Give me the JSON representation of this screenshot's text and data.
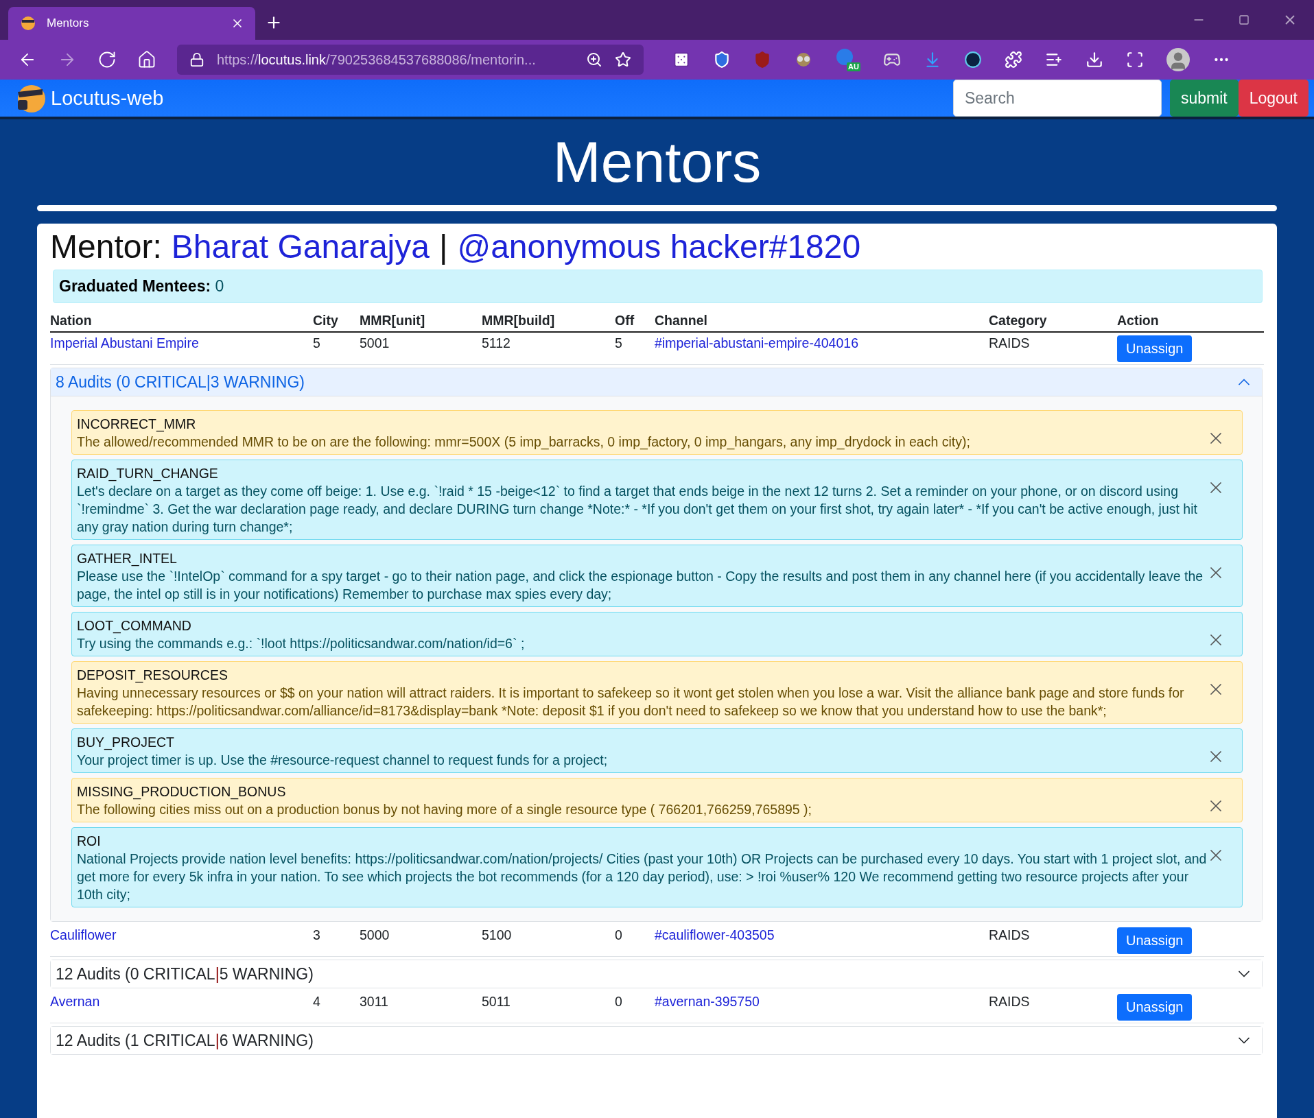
{
  "browser": {
    "tab_title": "Mentors",
    "url_scheme": "https://",
    "url_host": "locutus.link",
    "url_path": "/790253684537688086/mentorin...",
    "extension_badge": "AU"
  },
  "navbar": {
    "brand": "Locutus-web",
    "search": {
      "placeholder": "Search"
    },
    "buttons": [
      {
        "label": "submit",
        "kind": "submit"
      },
      {
        "label": "Logout",
        "kind": "logout"
      }
    ]
  },
  "page_title": "Mentors",
  "mentor": {
    "label": "Mentor:",
    "name": "Bharat Ganarajya",
    "separator": "|",
    "handle": "@anonymous hacker#1820"
  },
  "graduated": {
    "label": "Graduated Mentees:",
    "value": "0"
  },
  "table": {
    "columns": [
      "Nation",
      "City",
      "MMR[unit]",
      "MMR[build]",
      "Off",
      "Channel",
      "Category",
      "Action"
    ],
    "rows": [
      {
        "nation": "Imperial Abustani Empire",
        "city": "5",
        "mmr_unit": "5001",
        "mmr_build": "5112",
        "off": "5",
        "channel": "#imperial-abustani-empire-404016",
        "category": "RAIDS",
        "action": "Unassign",
        "audits": {
          "count": "8 Audits (0 CRITICAL",
          "separator": "|",
          "warnings": "3 WARNING)",
          "expanded": true,
          "items": [
            {
              "kind": "warning",
              "code": "INCORRECT_MMR",
              "message": "The allowed/recommended MMR to be on are the following: mmr=500X (5 imp_barracks, 0 imp_factory, 0 imp_hangars, any imp_drydock in each city);"
            },
            {
              "kind": "info",
              "code": "RAID_TURN_CHANGE",
              "message": "Let's declare on a target as they come off beige: 1. Use e.g. `!raid * 15 -beige<12` to find a target that ends beige in the next 12 turns 2. Set a reminder on your phone, or on discord using `!remindme` 3. Get the war declaration page ready, and declare DURING turn change *Note:* - *If you don't get them on your first shot, try again later* - *If you can't be active enough, just hit any gray nation during turn change*;"
            },
            {
              "kind": "info",
              "code": "GATHER_INTEL",
              "message": "Please use the `!IntelOp` command for a spy target - go to their nation page, and click the espionage button - Copy the results and post them in any channel here (if you accidentally leave the page, the intel op still is in your notifications) Remember to purchase max spies every day;"
            },
            {
              "kind": "info",
              "code": "LOOT_COMMAND",
              "message": "Try using the commands e.g.: `!loot https://politicsandwar.com/nation/id=6` ;"
            },
            {
              "kind": "warning",
              "code": "DEPOSIT_RESOURCES",
              "message": "Having unnecessary resources or $$ on your nation will attract raiders. It is important to safekeep so it wont get stolen when you lose a war. Visit the alliance bank page and store funds for safekeeping: https://politicsandwar.com/alliance/id=8173&display=bank *Note: deposit $1 if you don't need to safekeep so we know that you understand how to use the bank*;"
            },
            {
              "kind": "info",
              "code": "BUY_PROJECT",
              "message": "Your project timer is up. Use the #resource-request channel to request funds for a project;"
            },
            {
              "kind": "warning",
              "code": "MISSING_PRODUCTION_BONUS",
              "message": "The following cities miss out on a production bonus by not having more of a single resource type ( 766201,766259,765895 );"
            },
            {
              "kind": "info",
              "code": "ROI",
              "message": "National Projects provide nation level benefits: https://politicsandwar.com/nation/projects/ Cities (past your 10th) OR Projects can be purchased every 10 days. You start with 1 project slot, and get more for every 5k infra in your nation. To see which projects the bot recommends (for a 120 day period), use: > !roi %user% 120 We recommend getting two resource projects after your 10th city;"
            }
          ]
        }
      },
      {
        "nation": "Cauliflower",
        "city": "3",
        "mmr_unit": "5000",
        "mmr_build": "5100",
        "off": "0",
        "channel": "#cauliflower-403505",
        "category": "RAIDS",
        "action": "Unassign",
        "audits": {
          "count": "12 Audits (0 CRITICAL",
          "separator": "|",
          "warnings": "5 WARNING)",
          "expanded": false
        }
      },
      {
        "nation": "Avernan",
        "city": "4",
        "mmr_unit": "3011",
        "mmr_build": "5011",
        "off": "0",
        "channel": "#avernan-395750",
        "category": "RAIDS",
        "action": "Unassign",
        "audits": {
          "count": "12 Audits (1 CRITICAL",
          "separator": "|",
          "warnings": "6 WARNING)",
          "expanded": false
        }
      }
    ]
  }
}
